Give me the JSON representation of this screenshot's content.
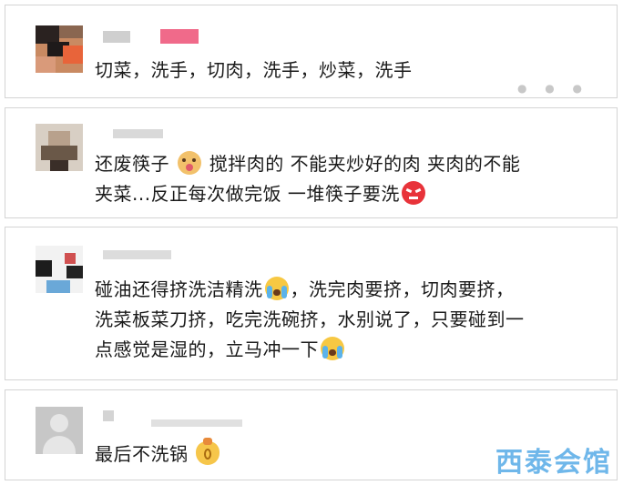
{
  "comments": [
    {
      "text": "切菜，洗手，切肉，洗手，炒菜，洗手"
    },
    {
      "line1_a": "还废筷子",
      "line1_b": "搅拌肉的 不能夹炒好的肉 夹肉的不能",
      "line2": "夹菜...反正每次做完饭 一堆筷子要洗",
      "emoji1": "doge-face-icon",
      "emoji2": "angry-face-icon"
    },
    {
      "line1_a": "碰油还得挤洗洁精洗",
      "line1_b": "，洗完肉要挤，切肉要挤，",
      "line2": "洗菜板菜刀挤，吃完洗碗挤，水别说了，只要碰到一",
      "line3": "点感觉是湿的，立马冲一下",
      "emoji1": "loudly-crying-face-icon",
      "emoji2": "loudly-crying-face-icon"
    },
    {
      "text": "最后不洗锅",
      "emoji": "money-bag-icon"
    }
  ],
  "watermark": "西泰会馆",
  "colors": {
    "border": "#d4d4d4",
    "text": "#1a1a1a",
    "blurred_name": "#cfcfcf",
    "blurred_tag": "#f06a8a",
    "watermark": "#6fb7ea"
  }
}
